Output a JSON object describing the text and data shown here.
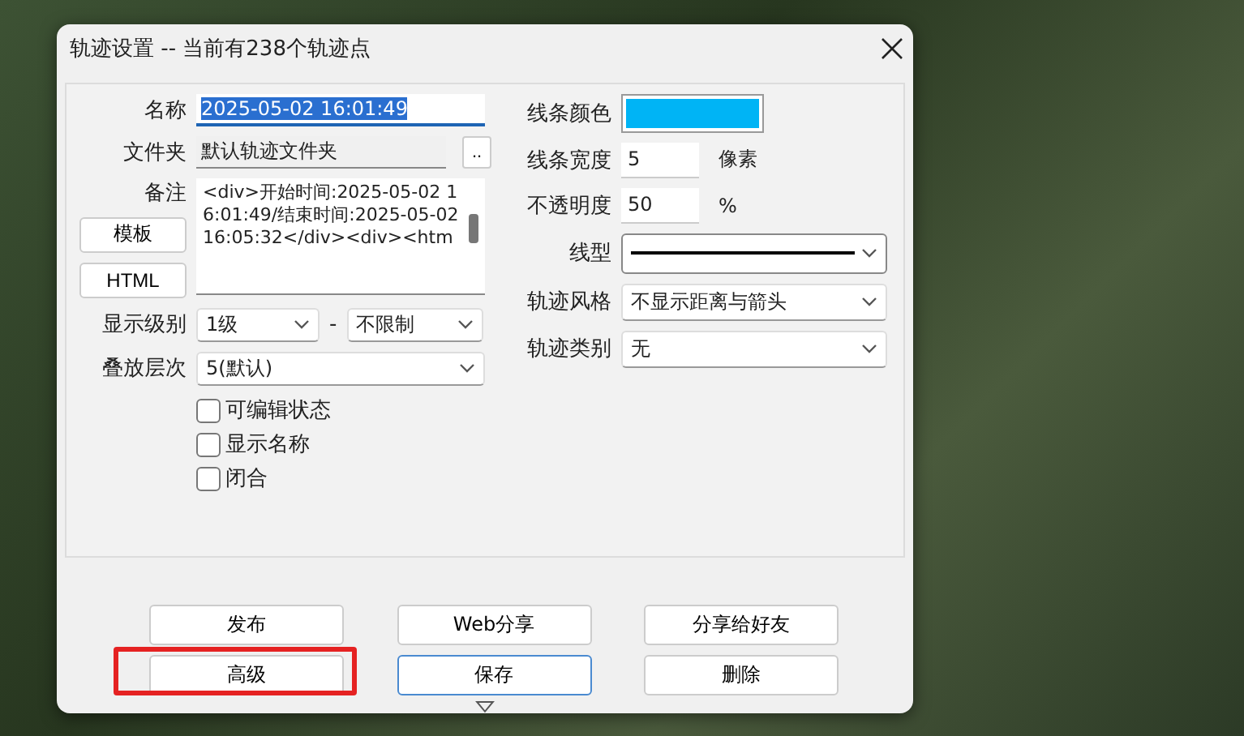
{
  "window": {
    "title": "轨迹设置 -- 当前有238个轨迹点"
  },
  "name_field": {
    "label": "名称",
    "value": "2025-05-02 16:01:49",
    "text_selected": true
  },
  "folder_field": {
    "label": "文件夹",
    "value": "默认轨迹文件夹",
    "browse": ".."
  },
  "memo_field": {
    "label": "备注",
    "value": "<div>开始时间:2025-05-02 16:01:49/结束时间:2025-05-02 16:05:32</div><div><htm"
  },
  "memo_buttons": [
    "模板",
    "HTML"
  ],
  "display_level": {
    "label": "显示级别",
    "from": "1级",
    "separator": "-",
    "to": "不限制"
  },
  "stack_order": {
    "label": "叠放层次",
    "value": "5(默认)"
  },
  "checkboxes": [
    {
      "label": "可编辑状态",
      "checked": false
    },
    {
      "label": "显示名称",
      "checked": false
    },
    {
      "label": "闭合",
      "checked": false
    }
  ],
  "line_color": {
    "label": "线条颜色",
    "color": "#00b4f5"
  },
  "line_width": {
    "label": "线条宽度",
    "value": "5",
    "unit": "像素"
  },
  "opacity": {
    "label": "不透明度",
    "value": "50",
    "unit": "%"
  },
  "line_type": {
    "label": "线型"
  },
  "track_style": {
    "label": "轨迹风格",
    "value": "不显示距离与箭头"
  },
  "track_category": {
    "label": "轨迹类别",
    "value": "无"
  },
  "buttons": [
    {
      "label": "发布",
      "focused": false,
      "highlighted": false
    },
    {
      "label": "Web分享",
      "focused": false,
      "highlighted": false
    },
    {
      "label": "分享给好友",
      "focused": false,
      "highlighted": false
    },
    {
      "label": "高级",
      "focused": false,
      "highlighted": true
    },
    {
      "label": "保存",
      "focused": true,
      "highlighted": false
    },
    {
      "label": "删除",
      "focused": false,
      "highlighted": false
    }
  ]
}
